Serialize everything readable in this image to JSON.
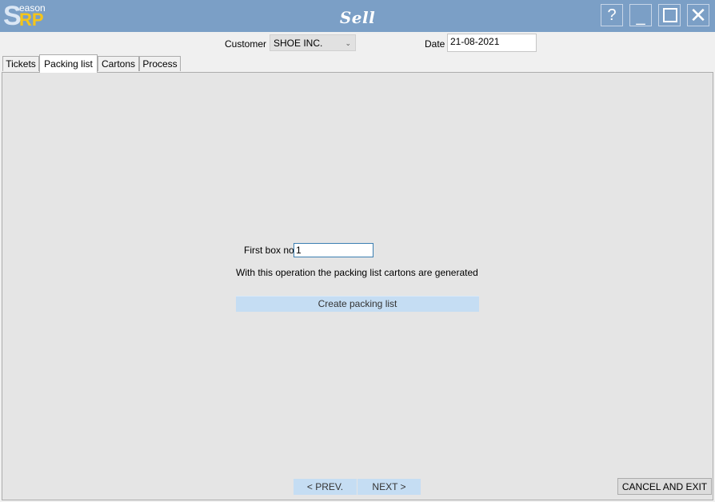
{
  "app": {
    "logo": {
      "S": "S",
      "eason": "eason",
      "RP": "RP"
    },
    "title": "Sell"
  },
  "window_controls": {
    "help": "?",
    "minimize": "_",
    "close": "✕"
  },
  "header": {
    "customer_label": "Customer",
    "customer_value": "SHOE INC.",
    "date_label": "Date",
    "date_value": "21-08-2021"
  },
  "tabs": [
    {
      "label": "Tickets",
      "active": false
    },
    {
      "label": "Packing list",
      "active": true
    },
    {
      "label": "Cartons",
      "active": false
    },
    {
      "label": "Process",
      "active": false
    }
  ],
  "packing": {
    "first_box_label": "First box no",
    "first_box_value": "1",
    "info_text": "With this operation the packing list cartons are generated",
    "create_button": "Create packing list"
  },
  "footer": {
    "prev_label": "< PREV.",
    "next_label": "NEXT >",
    "cancel_label": "CANCEL AND EXIT"
  },
  "colors": {
    "titlebar": "#7b9fc6",
    "button_blue": "#c5ddf3",
    "panel": "#e5e5e5",
    "logo_accent": "#f5c518"
  }
}
